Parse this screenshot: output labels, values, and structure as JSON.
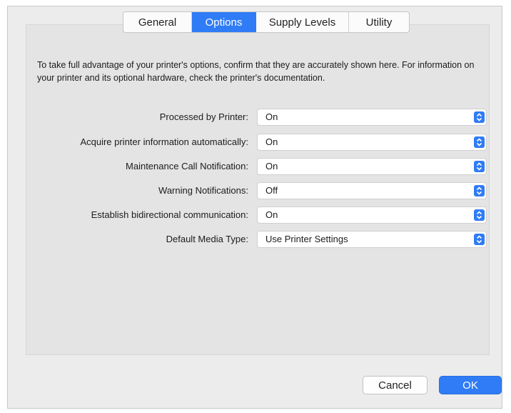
{
  "tabs": [
    {
      "label": "General",
      "active": false
    },
    {
      "label": "Options",
      "active": true
    },
    {
      "label": "Supply Levels",
      "active": false
    },
    {
      "label": "Utility",
      "active": false
    }
  ],
  "intro_text": "To take full advantage of your printer's options, confirm that they are accurately shown here. For information on your printer and its optional hardware, check the printer's documentation.",
  "settings": [
    {
      "label": "Processed by Printer:",
      "value": "On"
    },
    {
      "label": "Acquire printer information automatically:",
      "value": "On"
    },
    {
      "label": "Maintenance Call Notification:",
      "value": "On"
    },
    {
      "label": "Warning Notifications:",
      "value": "Off"
    },
    {
      "label": "Establish bidirectional communication:",
      "value": "On"
    },
    {
      "label": "Default Media Type:",
      "value": "Use Printer Settings"
    }
  ],
  "buttons": {
    "cancel": "Cancel",
    "ok": "OK"
  },
  "colors": {
    "accent": "#2f7cf6",
    "window_bg": "#ececec",
    "panel_bg": "#e4e4e4"
  },
  "icons": {
    "select_arrows": "up-down-chevron-icon"
  }
}
